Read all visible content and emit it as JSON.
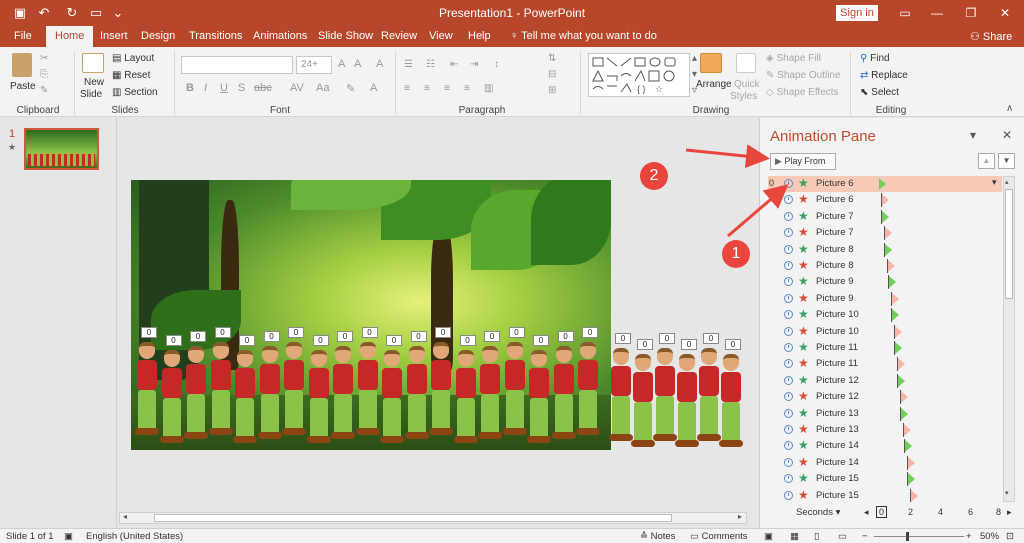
{
  "titlebar": {
    "title": "Presentation1 - PowerPoint",
    "sign_in": "Sign in",
    "qa_icons": [
      "save-icon",
      "undo-icon",
      "redo-icon",
      "from-beginning-icon",
      "customize-qat-icon"
    ]
  },
  "tabs": [
    "File",
    "Home",
    "Insert",
    "Design",
    "Transitions",
    "Animations",
    "Slide Show",
    "Review",
    "View",
    "Help"
  ],
  "active_tab": "Home",
  "tell_me": "Tell me what you want to do",
  "share": "Share",
  "ribbon": {
    "clipboard": {
      "label": "Clipboard",
      "paste": "Paste"
    },
    "slides": {
      "label": "Slides",
      "new_slide_1": "New",
      "new_slide_2": "Slide",
      "layout": "Layout",
      "reset": "Reset",
      "section": "Section"
    },
    "font": {
      "label": "Font",
      "size_placeholder": "24+",
      "bold": "B",
      "italic": "I",
      "underline": "U",
      "strike": "S",
      "shadow": "abc",
      "spacing": "AV",
      "case": "Aa"
    },
    "paragraph": {
      "label": "Paragraph"
    },
    "drawing": {
      "label": "Drawing",
      "arrange": "Arrange",
      "quick_styles_1": "Quick",
      "quick_styles_2": "Styles",
      "shape_fill": "Shape Fill",
      "shape_outline": "Shape Outline",
      "shape_effects": "Shape Effects"
    },
    "editing": {
      "label": "Editing",
      "find": "Find",
      "replace": "Replace",
      "select": "Select"
    }
  },
  "thumbnails": {
    "number": "1",
    "star": "★"
  },
  "slide": {
    "tags": [
      "0",
      "0",
      "0",
      "0",
      "0",
      "0",
      "0",
      "0",
      "0",
      "0",
      "0",
      "0",
      "0",
      "0",
      "0",
      "0",
      "0",
      "0",
      "0",
      "0",
      "0",
      "0",
      "0",
      "0",
      "0"
    ]
  },
  "animation_pane": {
    "title": "Animation Pane",
    "play_from": "Play From",
    "seconds": "Seconds",
    "first_num": "0",
    "items": [
      {
        "label": "Picture 6",
        "type": "entrance"
      },
      {
        "label": "Picture 6",
        "type": "exit"
      },
      {
        "label": "Picture 7",
        "type": "entrance"
      },
      {
        "label": "Picture 7",
        "type": "exit"
      },
      {
        "label": "Picture 8",
        "type": "entrance"
      },
      {
        "label": "Picture 8",
        "type": "exit"
      },
      {
        "label": "Picture 9",
        "type": "entrance"
      },
      {
        "label": "Picture 9",
        "type": "exit"
      },
      {
        "label": "Picture 10",
        "type": "entrance"
      },
      {
        "label": "Picture 10",
        "type": "exit"
      },
      {
        "label": "Picture 11",
        "type": "entrance"
      },
      {
        "label": "Picture 11",
        "type": "exit"
      },
      {
        "label": "Picture 12",
        "type": "entrance"
      },
      {
        "label": "Picture 12",
        "type": "exit"
      },
      {
        "label": "Picture 13",
        "type": "entrance"
      },
      {
        "label": "Picture 13",
        "type": "exit"
      },
      {
        "label": "Picture 14",
        "type": "entrance"
      },
      {
        "label": "Picture 14",
        "type": "exit"
      },
      {
        "label": "Picture 15",
        "type": "entrance"
      },
      {
        "label": "Picture 15",
        "type": "exit"
      }
    ],
    "ruler": [
      "0",
      "2",
      "4",
      "6",
      "8"
    ]
  },
  "callouts": [
    "1",
    "2"
  ],
  "status": {
    "slide_of": "Slide 1 of 1",
    "language": "English (United States)",
    "notes": "Notes",
    "comments": "Comments",
    "zoom": "50%"
  },
  "colors": {
    "brand": "#b7472a",
    "entrance_star": "#3aa064",
    "exit_star": "#d94c3a",
    "callout": "#e8453c"
  }
}
